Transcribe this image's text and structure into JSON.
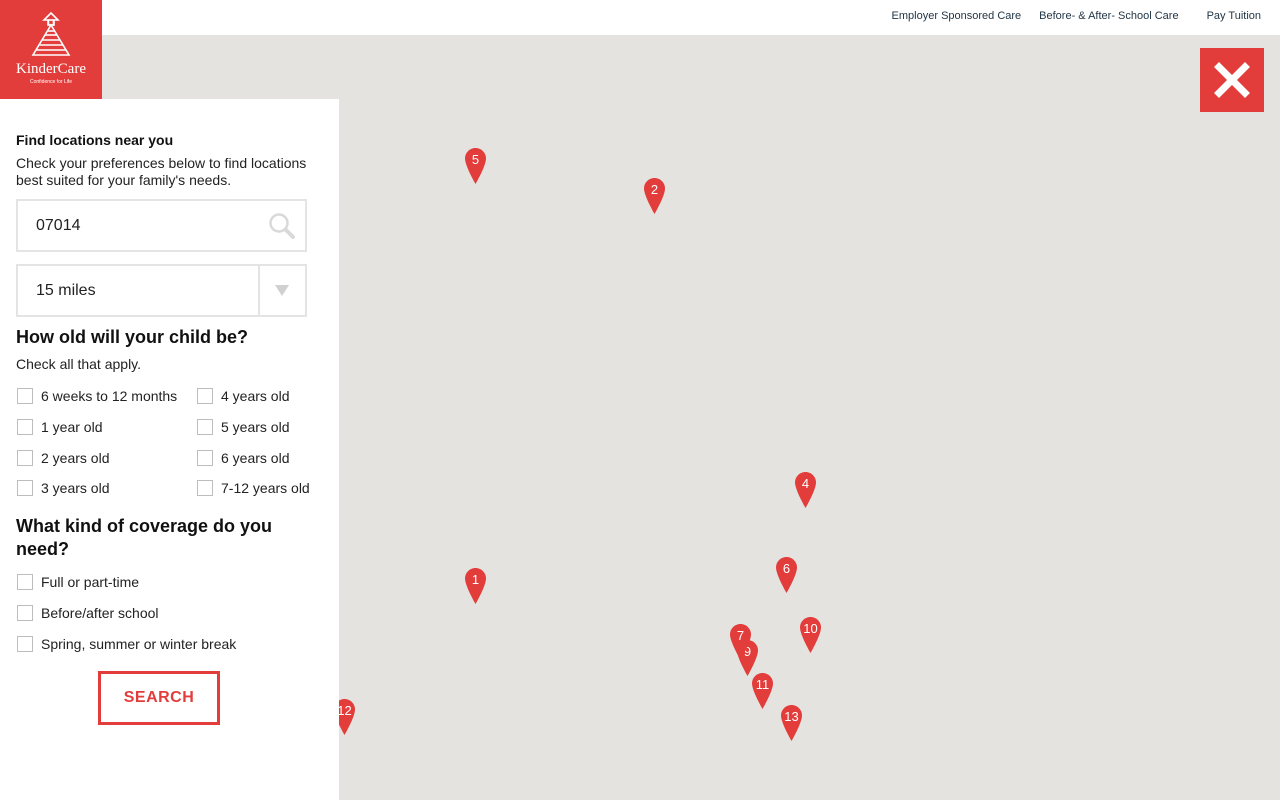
{
  "brand": {
    "name": "KinderCare",
    "tagline": "Confidence for Life",
    "accent_color": "#e23d3b"
  },
  "topnav": {
    "items": [
      {
        "label": "Employer Sponsored Care"
      },
      {
        "label": "Before- & After- School Care"
      },
      {
        "label": "Pay Tuition"
      }
    ]
  },
  "search": {
    "title": "Find locations near you",
    "description": "Check your preferences below to find locations best suited for your family's needs.",
    "zip_value": "07014",
    "radius_selected": "15 miles",
    "age_question": "How old will your child be?",
    "age_hint": "Check all that apply.",
    "age_options": [
      {
        "label": "6 weeks to 12 months",
        "checked": false
      },
      {
        "label": "4 years old",
        "checked": false
      },
      {
        "label": "1 year old",
        "checked": false
      },
      {
        "label": "5 years old",
        "checked": false
      },
      {
        "label": "2 years old",
        "checked": false
      },
      {
        "label": "6 years old",
        "checked": false
      },
      {
        "label": "3 years old",
        "checked": false
      },
      {
        "label": "7-12 years old",
        "checked": false
      }
    ],
    "coverage_question": "What kind of coverage do you need?",
    "coverage_options": [
      {
        "label": "Full or part-time",
        "checked": false
      },
      {
        "label": "Before/after school",
        "checked": false
      },
      {
        "label": "Spring, summer or winter break",
        "checked": false
      }
    ],
    "submit_label": "SEARCH"
  },
  "map": {
    "markers": [
      {
        "label": "1"
      },
      {
        "label": "2"
      },
      {
        "label": "4"
      },
      {
        "label": "5"
      },
      {
        "label": "6"
      },
      {
        "label": "7"
      },
      {
        "label": "9"
      },
      {
        "label": "10"
      },
      {
        "label": "11"
      },
      {
        "label": "12"
      },
      {
        "label": "13"
      }
    ]
  }
}
